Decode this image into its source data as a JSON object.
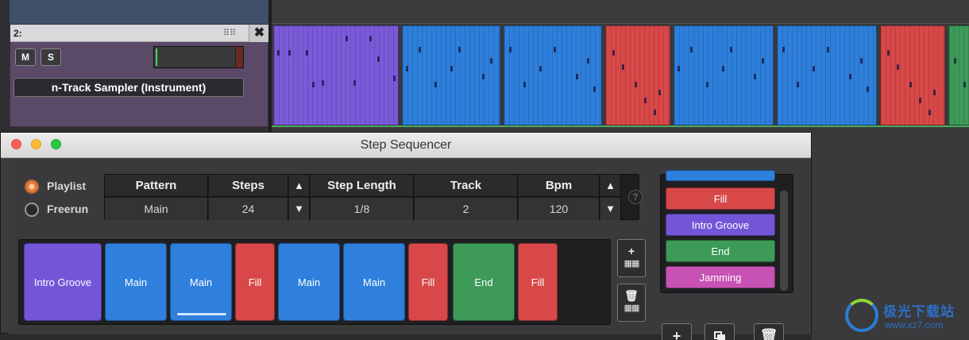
{
  "track": {
    "number": "2:",
    "options_glyph": "⠿⠿",
    "close_glyph": "✖",
    "mute_label": "M",
    "solo_label": "S",
    "instrument": "n-Track Sampler (Instrument)"
  },
  "sequencer": {
    "title": "Step Sequencer",
    "modes": {
      "playlist": "Playlist",
      "freerun": "Freerun",
      "selected": "Playlist"
    },
    "params": {
      "pattern_header": "Pattern",
      "pattern_value": "Main",
      "steps_header": "Steps",
      "steps_value": "24",
      "step_length_header": "Step Length",
      "step_length_value": "1/8",
      "track_header": "Track",
      "track_value": "2",
      "bpm_header": "Bpm",
      "bpm_value": "120",
      "up_arrow": "▲",
      "down_arrow": "▼",
      "help_glyph": "?"
    },
    "patterns": [
      {
        "label": "Intro Groove",
        "color": "#7356d8"
      },
      {
        "label": "Main",
        "color": "#2f7fdc"
      },
      {
        "label": "Main",
        "color": "#2f7fdc",
        "selected": true
      },
      {
        "label": "Fill",
        "color": "#d84848"
      },
      {
        "label": "Main",
        "color": "#2f7fdc"
      },
      {
        "label": "Main",
        "color": "#2f7fdc"
      },
      {
        "label": "Fill",
        "color": "#d84848"
      },
      {
        "label": "End",
        "color": "#3d9a58"
      },
      {
        "label": "Fill",
        "color": "#d84848"
      }
    ],
    "strip_tools": {
      "add_glyph": "+",
      "delete_glyph": "🗑",
      "keyboard_glyph": "▦▦"
    },
    "library": {
      "items": [
        {
          "label": "Fill",
          "color": "#d84848"
        },
        {
          "label": "Intro Groove",
          "color": "#7356d8"
        },
        {
          "label": "End",
          "color": "#3d9a58"
        },
        {
          "label": "Jamming",
          "color": "#c752b4"
        }
      ],
      "add_glyph": "+",
      "delete_glyph": "🗑"
    }
  },
  "timeline": {
    "clips": [
      {
        "color": "#7b5ad9"
      },
      {
        "color": "#2e7fdc"
      },
      {
        "color": "#2e7fdc"
      },
      {
        "color": "#d94848"
      },
      {
        "color": "#2e7fdc"
      },
      {
        "color": "#2e7fdc"
      },
      {
        "color": "#d94848"
      },
      {
        "color": "#3d9a58"
      }
    ]
  },
  "watermark": {
    "title": "极光下载站",
    "url": "www.xz7.com"
  }
}
